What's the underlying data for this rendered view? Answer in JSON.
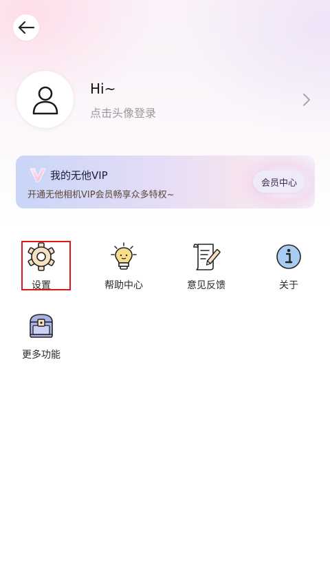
{
  "header": {
    "back_icon": "arrow-left-icon"
  },
  "profile": {
    "greeting": "Hi~",
    "login_hint": "点击头像登录",
    "avatar_icon": "user-icon",
    "chevron_icon": "chevron-right-icon"
  },
  "vip": {
    "title": "我的无他VIP",
    "subtitle": "开通无他相机VIP会员畅享众多特权~",
    "button_label": "会员中心",
    "logo_icon": "vip-v-icon"
  },
  "menu": {
    "items": [
      {
        "label": "设置",
        "icon": "gear-icon"
      },
      {
        "label": "帮助中心",
        "icon": "lightbulb-icon"
      },
      {
        "label": "意见反馈",
        "icon": "scroll-pen-icon"
      },
      {
        "label": "关于",
        "icon": "info-icon"
      },
      {
        "label": "更多功能",
        "icon": "treasure-chest-icon"
      }
    ]
  },
  "colors": {
    "highlight": "#e11414",
    "icon_fill": "#f5e1c2",
    "icon_outline": "#222222",
    "info_fill": "#a9cdf0",
    "chest_fill": "#a9b1e6"
  }
}
